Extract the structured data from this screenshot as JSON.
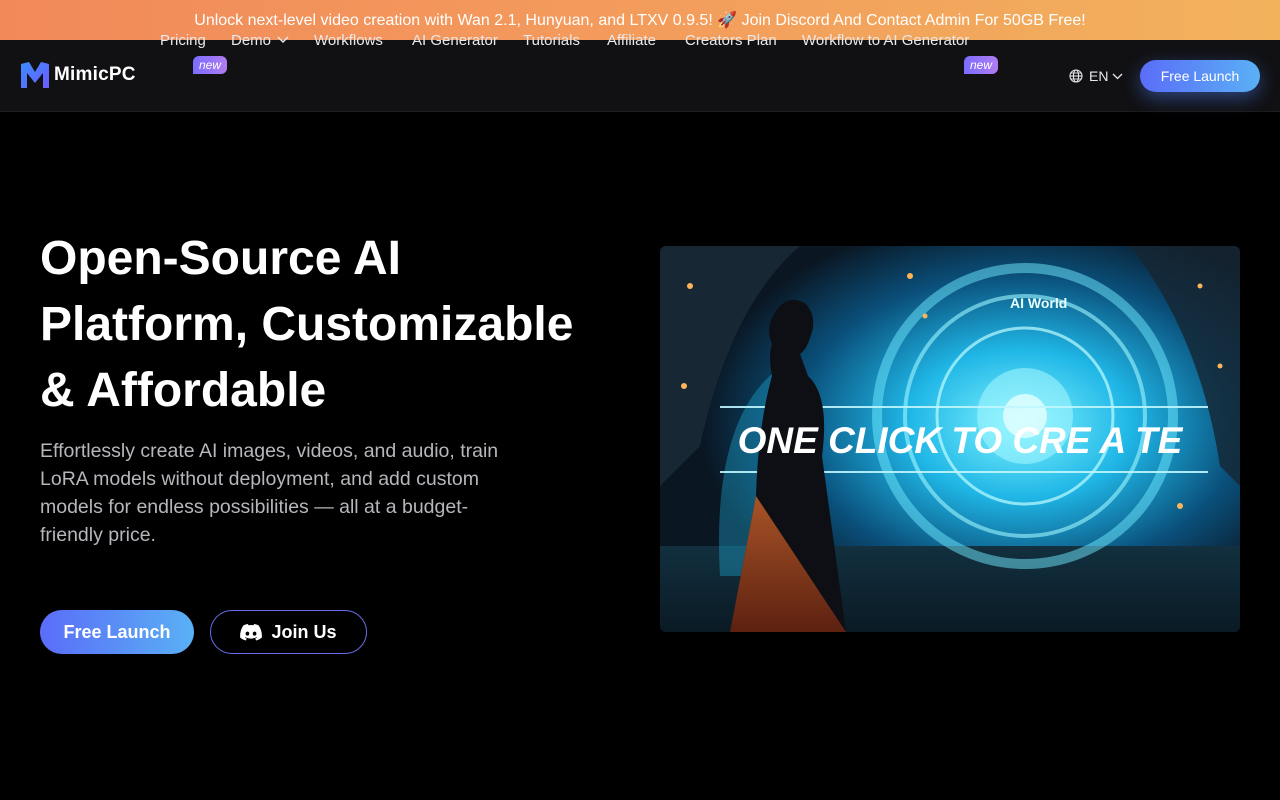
{
  "promo_banner": {
    "text": "Unlock next-level video creation with Wan 2.1, Hunyuan, and LTXV 0.9.5! 🚀 Join Discord And Contact Admin For 50GB Free!"
  },
  "header": {
    "logo_text": "MimicPC",
    "logo_icon": "mimicpc-logo-icon",
    "nav": [
      {
        "label": "Pricing",
        "badge": "new"
      },
      {
        "label": "Demo",
        "icon": "chevron-down-icon"
      },
      {
        "label": "Workflows"
      },
      {
        "label": "AI Generator"
      },
      {
        "label": "Tutorials"
      },
      {
        "label": "Affiliate"
      },
      {
        "label": "Creators Plan"
      },
      {
        "label": "Workflow to AI Generator",
        "badge": "new"
      }
    ],
    "language": {
      "icon": "globe-icon",
      "value": "EN"
    },
    "cta_label": "Free Launch"
  },
  "hero": {
    "title_lines": [
      "Open-Source AI",
      "Platform, Customizable",
      "& Affordable"
    ],
    "subtitle": "Effortlessly create AI images, videos, and audio, train LoRA models without deployment, and add custom models for endless possibilities — all at a budget-friendly price.",
    "primary_cta": "Free Launch",
    "secondary_cta": {
      "label": "Join Us",
      "icon": "discord-icon"
    },
    "media": {
      "portal_label": "AI World",
      "overlay_text": "ONE CLICK TO CRE A TE"
    }
  },
  "colors": {
    "banner_gradient": [
      "#f2895a",
      "#f2b25c"
    ],
    "accent_gradient": [
      "#5a6df8",
      "#5ab0f5"
    ],
    "badge_gradient": [
      "#7b6cff",
      "#b07cf0"
    ],
    "page_bg": "#000000",
    "nav_bg": "#111113"
  }
}
